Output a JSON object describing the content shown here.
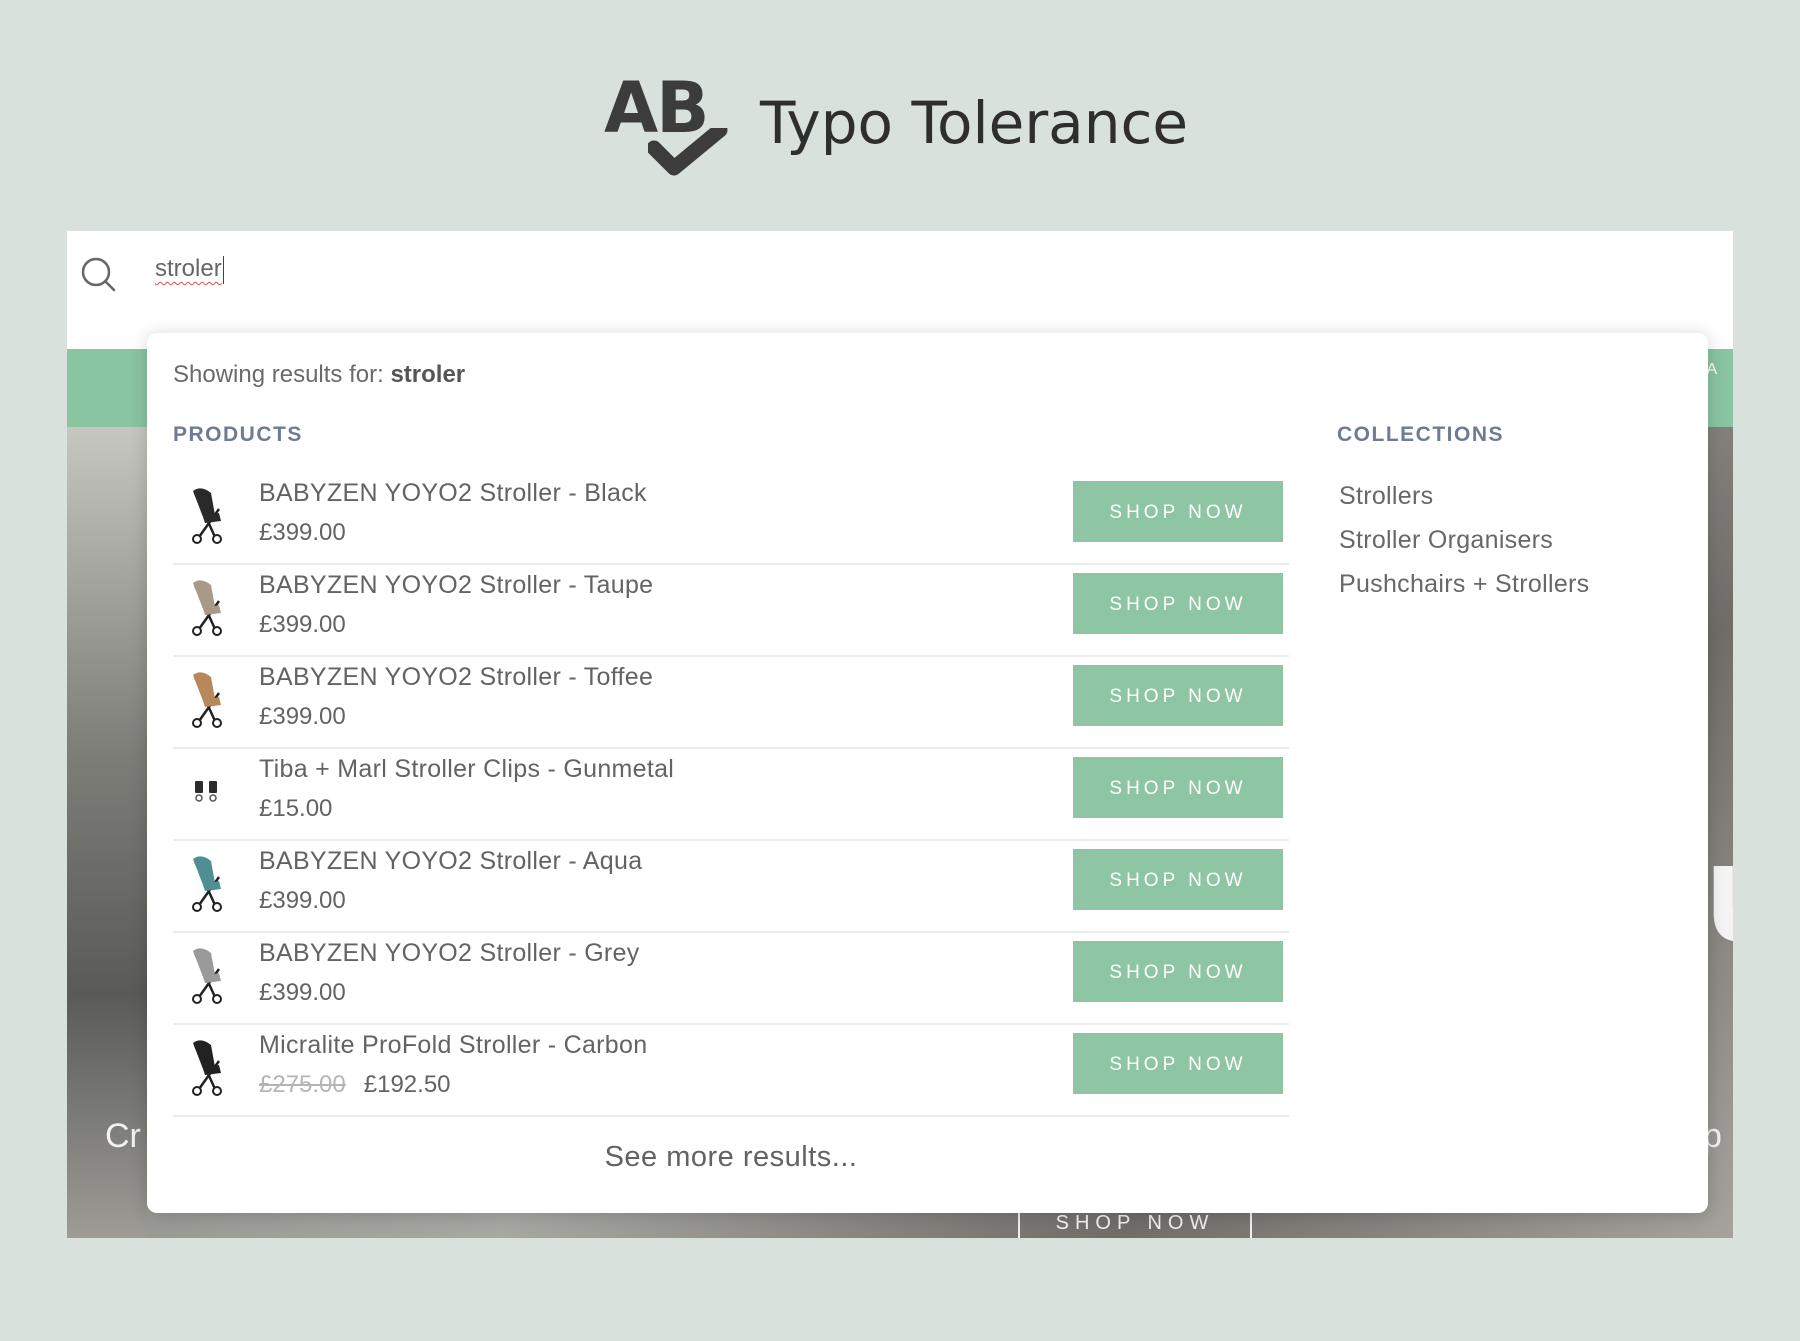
{
  "header": {
    "logo_text": "AB",
    "title": "Typo Tolerance"
  },
  "search": {
    "query": "stroler"
  },
  "background": {
    "left_text": "Cr",
    "right_text": "p",
    "big_letter": "u",
    "band_letters": "IA",
    "shop_now": "SHOP NOW"
  },
  "dropdown": {
    "showing_prefix": "Showing results for: ",
    "showing_term": "stroler",
    "products_title": "PRODUCTS",
    "collections_title": "COLLECTIONS",
    "products": [
      {
        "name": "BABYZEN YOYO2 Stroller - Black",
        "price": "£399.00",
        "button": "SHOP NOW",
        "seat_color": "#2a2a2a"
      },
      {
        "name": "BABYZEN YOYO2 Stroller - Taupe",
        "price": "£399.00",
        "button": "SHOP NOW",
        "seat_color": "#a89a86"
      },
      {
        "name": "BABYZEN YOYO2 Stroller - Toffee",
        "price": "£399.00",
        "button": "SHOP NOW",
        "seat_color": "#b8875a"
      },
      {
        "name": "Tiba + Marl Stroller Clips - Gunmetal",
        "price": "£15.00",
        "button": "SHOP NOW",
        "seat_color": "#333333"
      },
      {
        "name": "BABYZEN YOYO2 Stroller - Aqua",
        "price": "£399.00",
        "button": "SHOP NOW",
        "seat_color": "#4f8e93"
      },
      {
        "name": "BABYZEN YOYO2 Stroller - Grey",
        "price": "£399.00",
        "button": "SHOP NOW",
        "seat_color": "#9a9a9a"
      },
      {
        "name": "Micralite ProFold Stroller - Carbon",
        "old_price": "£275.00",
        "price": "£192.50",
        "button": "SHOP NOW",
        "seat_color": "#222222"
      }
    ],
    "collections": [
      "Strollers",
      "Stroller Organisers",
      "Pushchairs + Strollers"
    ],
    "see_more": "See more results..."
  },
  "colors": {
    "page_bg": "#d8e1dc",
    "accent_green": "#8ec5a2",
    "section_title": "#6f7b95"
  }
}
